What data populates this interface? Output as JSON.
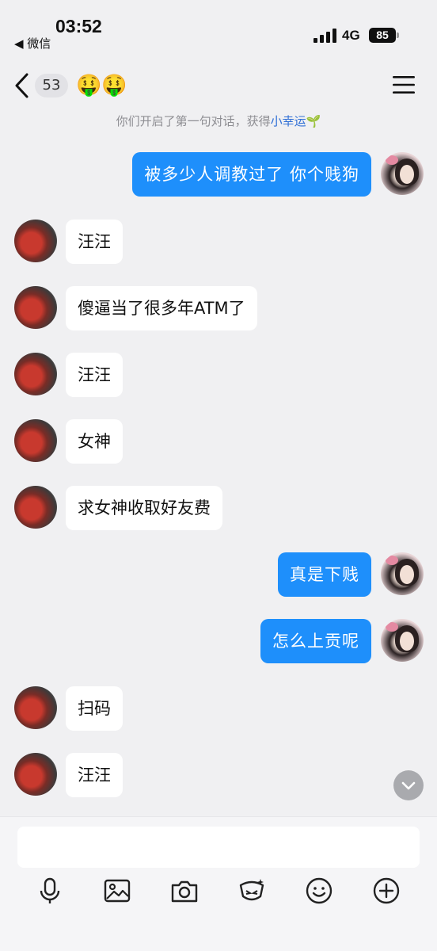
{
  "status_bar": {
    "time": "03:52",
    "back_app": "◀ 微信",
    "network": "4G",
    "battery": "85"
  },
  "header": {
    "unread_count": "53",
    "title": "🤑🤑"
  },
  "system_message": {
    "prefix": "你们开启了第一句对话，获得",
    "highlight": "小幸运",
    "emoji": "🌱"
  },
  "messages": [
    {
      "side": "right",
      "text": "被多少人调教过了 你个贱狗"
    },
    {
      "side": "left",
      "text": "汪汪"
    },
    {
      "side": "left",
      "text": "傻逼当了很多年ATM了"
    },
    {
      "side": "left",
      "text": "汪汪"
    },
    {
      "side": "left",
      "text": "女神"
    },
    {
      "side": "left",
      "text": "求女神收取好友费"
    },
    {
      "side": "right",
      "text": "真是下贱"
    },
    {
      "side": "right",
      "text": "怎么上贡呢"
    },
    {
      "side": "left",
      "text": "扫码"
    },
    {
      "side": "left",
      "text": "汪汪"
    }
  ],
  "input": {
    "placeholder": ""
  },
  "toolbar": {
    "icons": [
      "microphone-icon",
      "image-icon",
      "camera-icon",
      "sticker-icon",
      "emoji-icon",
      "plus-icon"
    ]
  },
  "colors": {
    "sent_bubble": "#1e8ffb",
    "received_bubble": "#ffffff",
    "background": "#f0f0f2",
    "link": "#2f6fd6"
  }
}
